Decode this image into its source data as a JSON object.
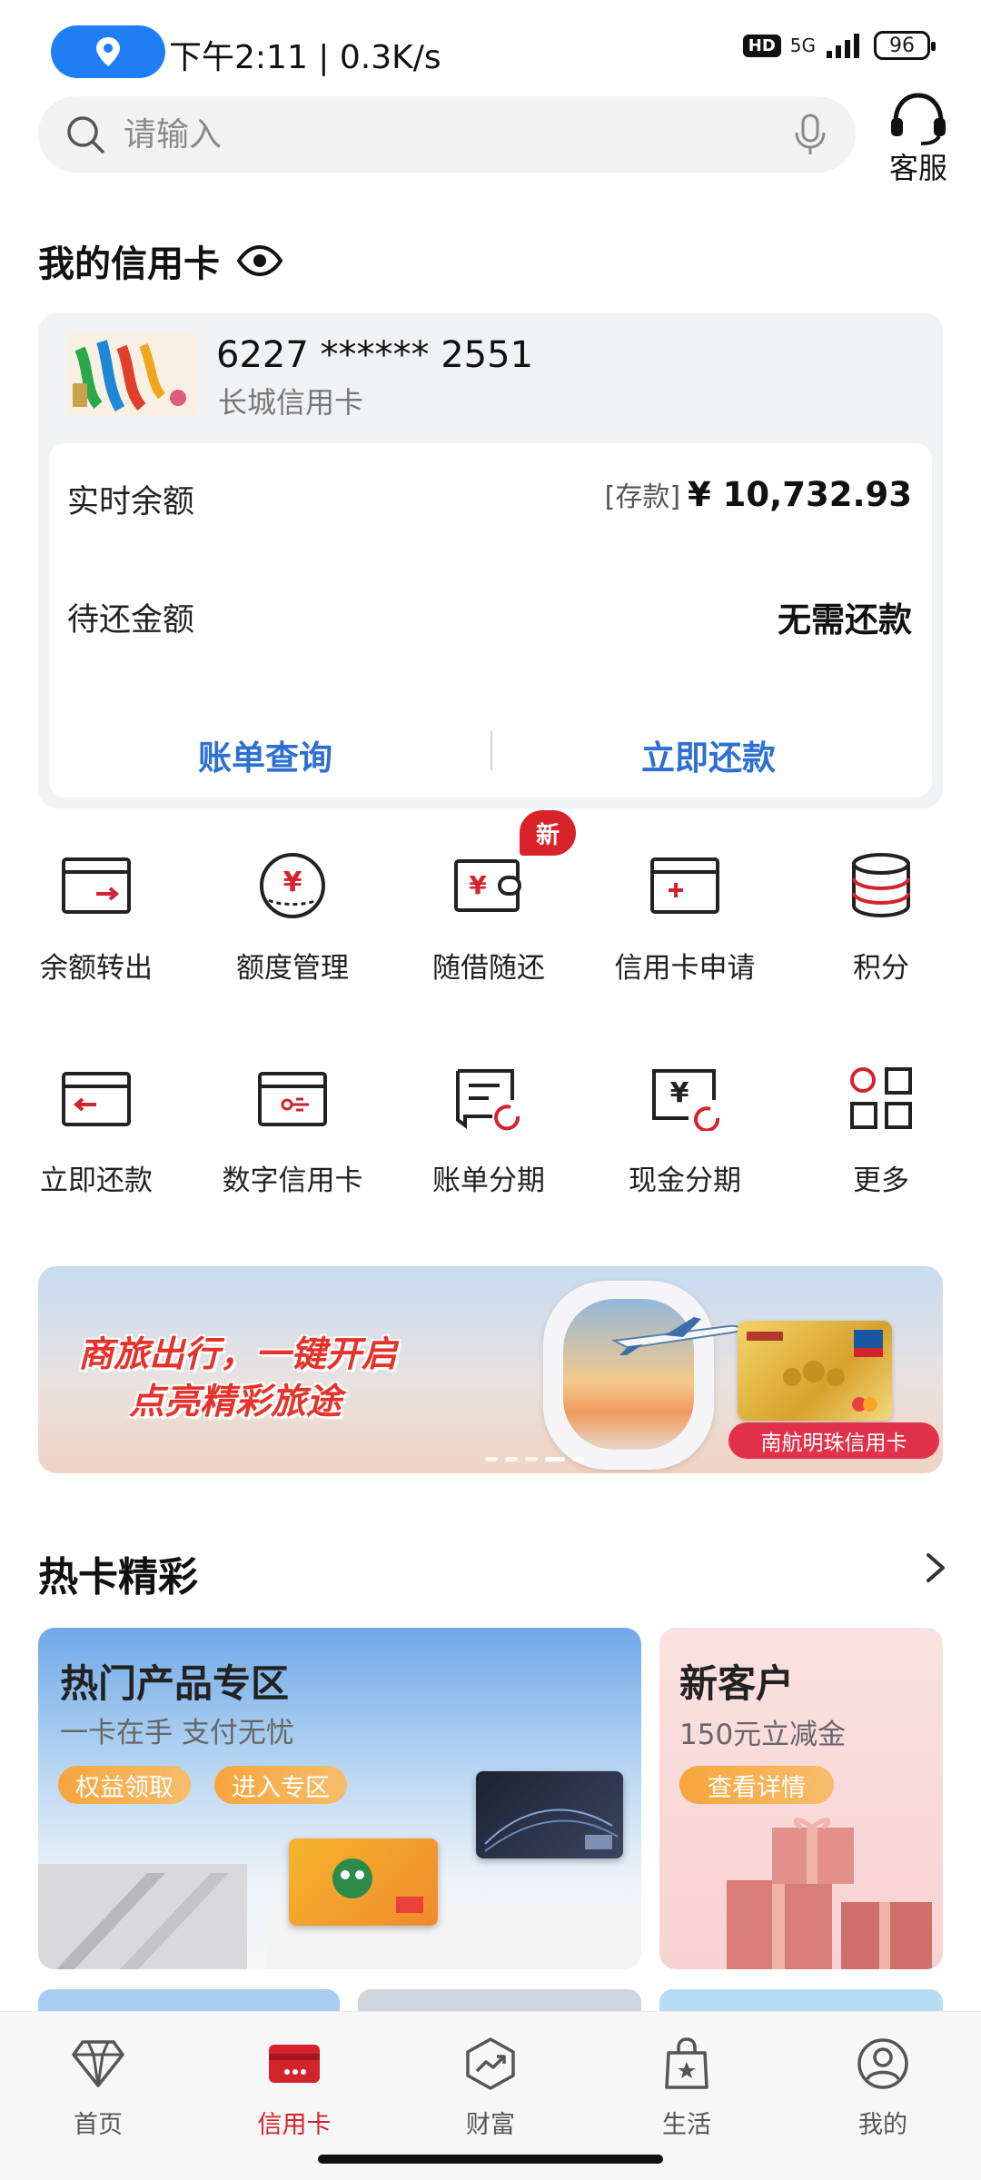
{
  "status_bar": {
    "time_speed": "下午2:11 | 0.3K/s",
    "hd": "HD",
    "network": "5G",
    "battery": "96"
  },
  "search": {
    "placeholder": "请输入"
  },
  "service": {
    "label": "客服"
  },
  "my_card": {
    "title": "我的信用卡",
    "card_number": "6227 ****** 2551",
    "card_name": "长城信用卡",
    "balance_label": "实时余额",
    "balance_tag": "[存款]",
    "balance_value": "¥ 10,732.93",
    "due_label": "待还金额",
    "due_value": "无需还款",
    "bill_link": "账单查询",
    "repay_link": "立即还款"
  },
  "grid": {
    "badge": "新",
    "items": [
      {
        "label": "余额转出",
        "icon": "transfer-out-icon"
      },
      {
        "label": "额度管理",
        "icon": "limit-icon"
      },
      {
        "label": "随借随还",
        "icon": "wallet-icon"
      },
      {
        "label": "信用卡申请",
        "icon": "card-apply-icon"
      },
      {
        "label": "积分",
        "icon": "points-icon"
      },
      {
        "label": "立即还款",
        "icon": "repay-icon"
      },
      {
        "label": "数字信用卡",
        "icon": "digital-card-icon"
      },
      {
        "label": "账单分期",
        "icon": "bill-installment-icon"
      },
      {
        "label": "现金分期",
        "icon": "cash-installment-icon"
      },
      {
        "label": "更多",
        "icon": "more-icon"
      }
    ]
  },
  "banner": {
    "line1": "商旅出行，一键开启",
    "line2": "点亮精彩旅途",
    "tag": "南航明珠信用卡"
  },
  "hot": {
    "title": "热卡精彩",
    "big": {
      "title": "热门产品专区",
      "subtitle": "一卡在手 支付无忧",
      "btn1": "权益领取",
      "btn2": "进入专区"
    },
    "small": {
      "title": "新客户",
      "subtitle": "150元立减金",
      "btn": "查看详情"
    }
  },
  "nav": {
    "items": [
      {
        "label": "首页"
      },
      {
        "label": "信用卡"
      },
      {
        "label": "财富"
      },
      {
        "label": "生活"
      },
      {
        "label": "我的"
      }
    ]
  },
  "colors": {
    "accent_red": "#d3232c",
    "link_blue": "#2e6fd2",
    "status_blue": "#1e7ff5"
  }
}
